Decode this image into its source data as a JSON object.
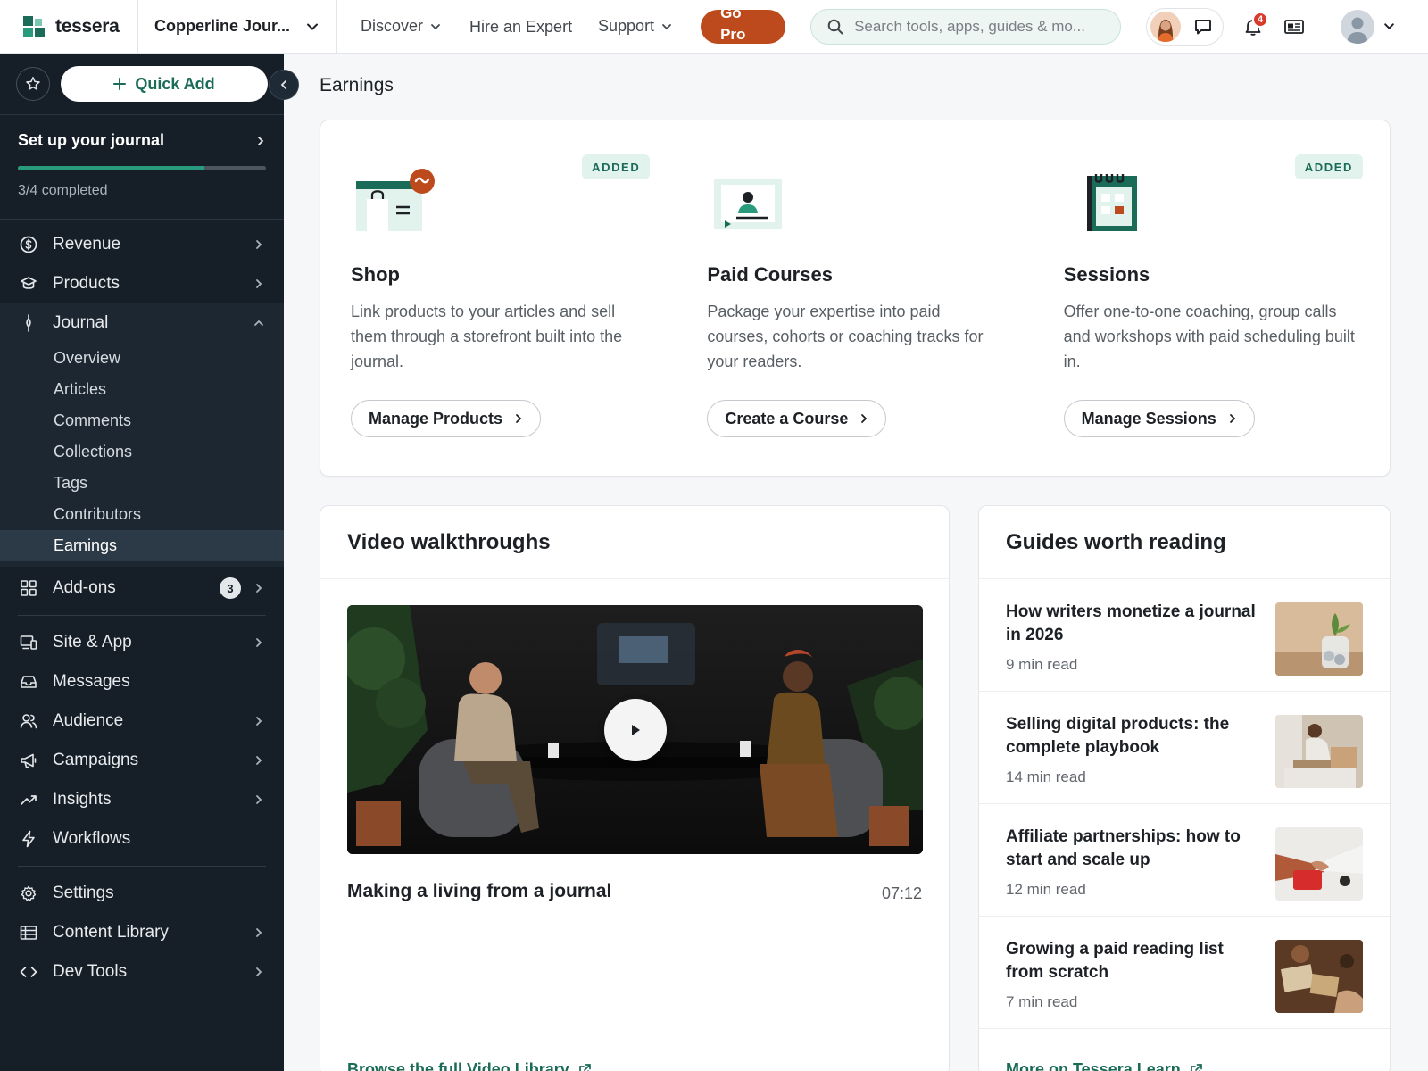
{
  "topbar": {
    "brand": "tessera",
    "site_name": "Copperline Jour...",
    "nav": {
      "discover": "Discover",
      "hire": "Hire an Expert",
      "support": "Support"
    },
    "go_pro": "Go Pro",
    "search_placeholder": "Search tools, apps, guides & mo...",
    "notification_count": "4"
  },
  "sidebar": {
    "quick_add": "Quick Add",
    "setup": {
      "title": "Set up your journal",
      "progress_fraction": 0.75,
      "completed_text": "3/4 completed"
    },
    "items": [
      {
        "label": "Revenue",
        "icon": "dollar-icon"
      },
      {
        "label": "Products",
        "icon": "box-icon"
      },
      {
        "label": "Journal",
        "icon": "pen-nib-icon"
      }
    ],
    "journal_sub": [
      "Overview",
      "Articles",
      "Comments",
      "Collections",
      "Tags",
      "Contributors",
      "Earnings"
    ],
    "addons": {
      "label": "Add-ons",
      "count": "3"
    },
    "group2": [
      {
        "label": "Site & App",
        "icon": "devices-icon"
      },
      {
        "label": "Messages",
        "icon": "inbox-icon"
      },
      {
        "label": "Audience",
        "icon": "people-icon"
      },
      {
        "label": "Campaigns",
        "icon": "megaphone-icon"
      },
      {
        "label": "Insights",
        "icon": "trend-icon"
      },
      {
        "label": "Workflows",
        "icon": "bolt-icon"
      }
    ],
    "group3": [
      {
        "label": "Settings",
        "icon": "gear-icon"
      },
      {
        "label": "Content Library",
        "icon": "table-icon"
      },
      {
        "label": "Dev Tools",
        "icon": "code-icon"
      }
    ]
  },
  "main": {
    "title": "Earnings",
    "features": [
      {
        "title": "Shop",
        "badge": "ADDED",
        "desc": "Link products to your articles and sell them through a storefront built into the journal.",
        "button": "Manage Products"
      },
      {
        "title": "Paid Courses",
        "badge": "",
        "desc": "Package your expertise into paid courses, cohorts or coaching tracks for your readers.",
        "button": "Create a Course"
      },
      {
        "title": "Sessions",
        "badge": "ADDED",
        "desc": "Offer one-to-one coaching, group calls and workshops with paid scheduling built in.",
        "button": "Manage Sessions"
      }
    ],
    "video": {
      "heading": "Video walkthroughs",
      "title": "Making a living from a journal",
      "duration": "07:12",
      "footer": "Browse the full Video Library"
    },
    "guides": {
      "heading": "Guides worth reading",
      "items": [
        {
          "title": "How writers monetize a journal in 2026",
          "meta": "9 min read"
        },
        {
          "title": "Selling digital products: the complete playbook",
          "meta": "14 min read"
        },
        {
          "title": "Affiliate partnerships: how to start and scale up",
          "meta": "12 min read"
        },
        {
          "title": "Growing a paid reading list from scratch",
          "meta": "7 min read"
        }
      ],
      "footer": "More on Tessera Learn"
    }
  },
  "colors": {
    "accent": "#1a6b57",
    "brand_orange": "#bd4a1c",
    "sidebar_bg": "#161f28"
  }
}
